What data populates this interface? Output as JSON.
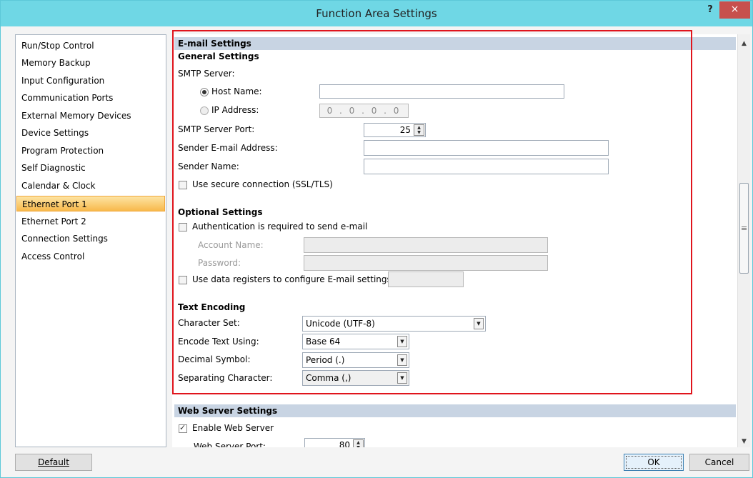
{
  "window": {
    "title": "Function Area Settings",
    "help": "?",
    "close": "×"
  },
  "nav": {
    "items": [
      {
        "label": "Run/Stop Control"
      },
      {
        "label": "Memory Backup"
      },
      {
        "label": "Input Configuration"
      },
      {
        "label": "Communication Ports"
      },
      {
        "label": "External Memory Devices"
      },
      {
        "label": "Device Settings"
      },
      {
        "label": "Program Protection"
      },
      {
        "label": "Self Diagnostic"
      },
      {
        "label": "Calendar & Clock"
      },
      {
        "label": "Ethernet Port 1",
        "selected": true
      },
      {
        "label": "Ethernet Port 2"
      },
      {
        "label": "Connection Settings"
      },
      {
        "label": "Access Control"
      }
    ]
  },
  "email": {
    "header": "E-mail Settings",
    "general_title": "General Settings",
    "smtp_server_label": "SMTP Server:",
    "host_name_label": "Host Name:",
    "host_name_value": "",
    "ip_label": "IP Address:",
    "ip_value": "0 . 0 . 0 . 0",
    "smtp_port_label": "SMTP Server Port:",
    "smtp_port_value": "25",
    "sender_email_label": "Sender E-mail Address:",
    "sender_email_value": "",
    "sender_name_label": "Sender Name:",
    "sender_name_value": "",
    "secure_label": "Use secure connection (SSL/TLS)",
    "optional_title": "Optional Settings",
    "auth_label": "Authentication is required to send e-mail",
    "account_label": "Account Name:",
    "password_label": "Password:",
    "data_reg_label": "Use data registers to configure E-mail settings:",
    "text_encoding_title": "Text Encoding",
    "charset_label": "Character Set:",
    "charset_value": "Unicode (UTF-8)",
    "encode_label": "Encode Text Using:",
    "encode_value": "Base 64",
    "decimal_label": "Decimal Symbol:",
    "decimal_value": "Period (.)",
    "separator_label": "Separating Character:",
    "separator_value": "Comma (,)"
  },
  "web": {
    "header": "Web Server Settings",
    "enable_label": "Enable Web Server",
    "enable_checked": true,
    "port_label": "Web Server Port:",
    "port_value": "80"
  },
  "buttons": {
    "default": "Default",
    "ok": "OK",
    "cancel": "Cancel"
  },
  "colors": {
    "titlebar": "#6fd7e5",
    "close": "#c7504d",
    "highlight_box": "#e0141c",
    "section_header": "#c8d4e3"
  }
}
